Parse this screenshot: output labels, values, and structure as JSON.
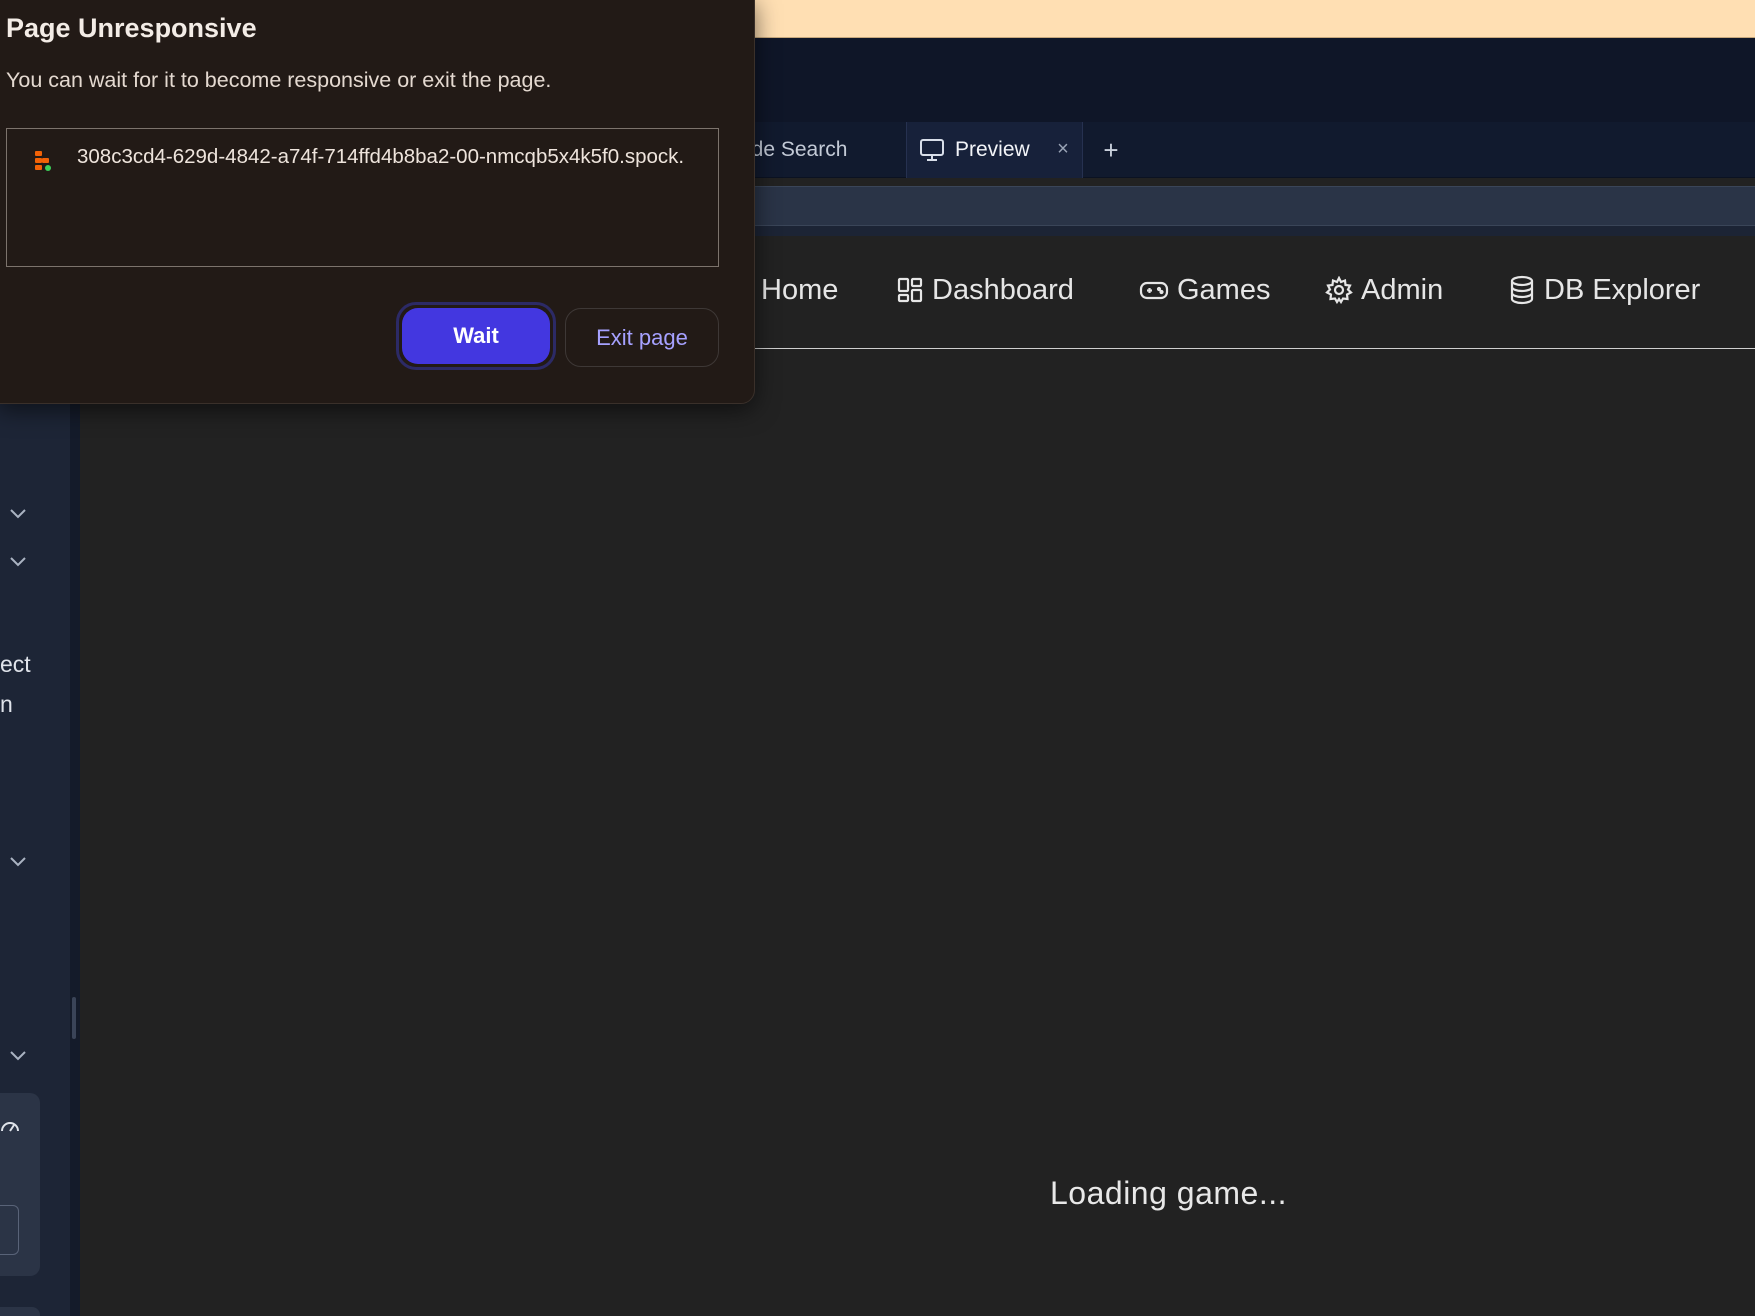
{
  "dialog": {
    "title": "Page Unresponsive",
    "message": "You can wait for it to become responsive or exit the page.",
    "url": "308c3cd4-629d-4842-a74f-714ffd4b8ba2-00-nmcqb5x4k5f0.spock.",
    "wait_label": "Wait",
    "exit_label": "Exit page",
    "wait_color": "#4337e0",
    "exit_text_color": "#a6a1ff"
  },
  "tabs": {
    "code_search_label": "ode Search",
    "preview_label": "Preview",
    "close_glyph": "×",
    "new_tab_glyph": "+"
  },
  "nav": {
    "items": [
      {
        "label": "Home",
        "icon": "home-icon"
      },
      {
        "label": "Dashboard",
        "icon": "dashboard-grid-icon"
      },
      {
        "label": "Games",
        "icon": "gamepad-icon"
      },
      {
        "label": "Admin",
        "icon": "gear-icon"
      },
      {
        "label": "DB Explorer",
        "icon": "database-icon"
      }
    ]
  },
  "sidebar": {
    "text_1": "ect",
    "text_2": "n"
  },
  "main": {
    "loading_text": "Loading game..."
  },
  "colors": {
    "banner": "#ffdfb3",
    "topbar": "#0f1628",
    "background": "#222222"
  }
}
